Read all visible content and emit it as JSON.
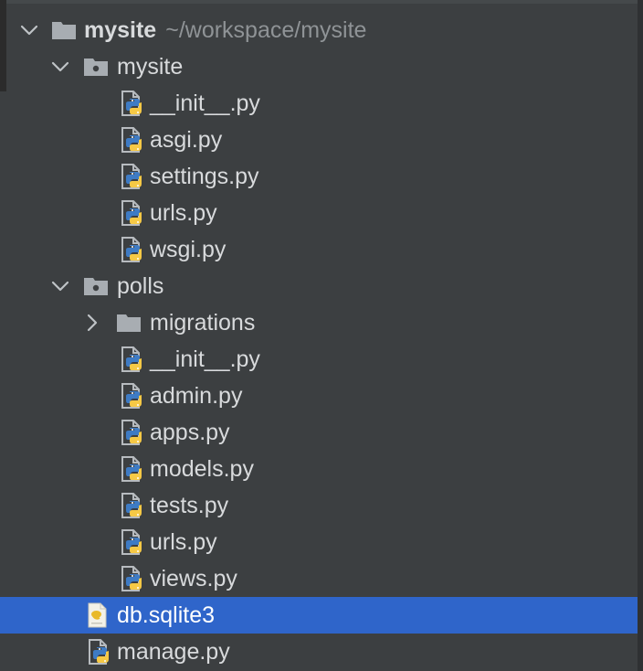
{
  "project_tree": {
    "root": {
      "name": "mysite",
      "path": "~/workspace/mysite",
      "icon": "folder-icon",
      "expanded": true
    },
    "mysite_package": {
      "name": "mysite",
      "icon": "package-folder-icon",
      "expanded": true,
      "files": [
        "__init__.py",
        "asgi.py",
        "settings.py",
        "urls.py",
        "wsgi.py"
      ]
    },
    "polls_package": {
      "name": "polls",
      "icon": "package-folder-icon",
      "expanded": true,
      "subfolder": {
        "name": "migrations",
        "icon": "folder-icon",
        "expanded": false
      },
      "files": [
        "__init__.py",
        "admin.py",
        "apps.py",
        "models.py",
        "tests.py",
        "urls.py",
        "views.py"
      ]
    },
    "root_files": [
      {
        "name": "db.sqlite3",
        "icon": "sqlite-file-icon",
        "selected": true
      },
      {
        "name": "manage.py",
        "icon": "python-file-icon",
        "selected": false
      }
    ]
  },
  "colors": {
    "background": "#3c3f41",
    "selection": "#2f65ca",
    "text": "#d8dadc",
    "path_text": "#8f9396",
    "python_blue": "#3e7bc4",
    "python_yellow": "#f6c945"
  }
}
